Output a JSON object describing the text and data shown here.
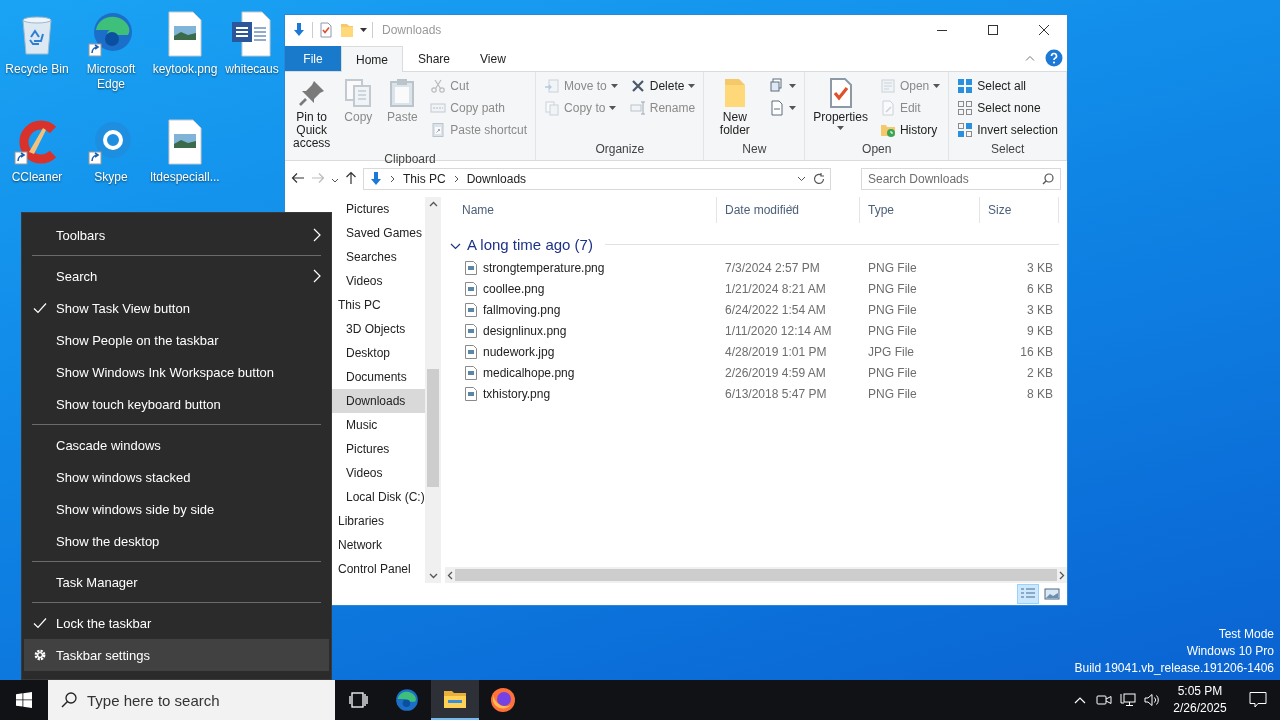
{
  "desktop": {
    "icons": [
      {
        "label": "Recycle Bin"
      },
      {
        "label": "Microsoft Edge"
      },
      {
        "label": "keytook.png"
      },
      {
        "label": "whitecaus"
      },
      {
        "label": "CCleaner"
      },
      {
        "label": "Skype"
      },
      {
        "label": "ltdespeciall..."
      }
    ],
    "watermark": [
      "Test Mode",
      "Windows 10 Pro",
      "Build 19041.vb_release.191206-1406"
    ]
  },
  "explorer": {
    "title": "Downloads",
    "tabs": [
      {
        "label": "File",
        "kind": "file",
        "selected": false
      },
      {
        "label": "Home",
        "kind": "tab",
        "selected": true
      },
      {
        "label": "Share",
        "kind": "tab",
        "selected": false
      },
      {
        "label": "View",
        "kind": "tab",
        "selected": false
      }
    ],
    "ribbon": [
      {
        "label": "Clipboard",
        "columns": [
          [
            {
              "label": "Pin to Quick access",
              "kind": "large",
              "disabled": false,
              "dropdown": false
            }
          ],
          [
            {
              "label": "Copy",
              "kind": "large",
              "disabled": true,
              "dropdown": false
            }
          ],
          [
            {
              "label": "Paste",
              "kind": "large",
              "disabled": true,
              "dropdown": false
            }
          ],
          [
            {
              "label": "Cut",
              "kind": "small",
              "disabled": true,
              "dropdown": false
            },
            {
              "label": "Copy path",
              "kind": "small",
              "disabled": true,
              "dropdown": false
            },
            {
              "label": "Paste shortcut",
              "kind": "small",
              "disabled": true,
              "dropdown": false
            }
          ]
        ]
      },
      {
        "label": "Organize",
        "columns": [
          [
            {
              "label": "Move to",
              "kind": "small",
              "disabled": true,
              "dropdown": true
            },
            {
              "label": "Copy to",
              "kind": "small",
              "disabled": true,
              "dropdown": true
            }
          ],
          [
            {
              "label": "Delete",
              "kind": "small",
              "disabled": false,
              "dropdown": true
            },
            {
              "label": "Rename",
              "kind": "small",
              "disabled": true,
              "dropdown": false
            }
          ]
        ]
      },
      {
        "label": "New",
        "columns": [
          [
            {
              "label": "New folder",
              "kind": "large",
              "disabled": false,
              "dropdown": false
            }
          ],
          [
            {
              "kind": "icon",
              "disabled": false,
              "dropdown": true
            },
            {
              "kind": "icon",
              "disabled": false,
              "dropdown": true
            }
          ]
        ]
      },
      {
        "label": "Open",
        "columns": [
          [
            {
              "label": "Properties",
              "kind": "large",
              "disabled": false,
              "dropdown": true
            }
          ],
          [
            {
              "label": "Open",
              "kind": "small",
              "disabled": true,
              "dropdown": true
            },
            {
              "label": "Edit",
              "kind": "small",
              "disabled": true,
              "dropdown": false
            },
            {
              "label": "History",
              "kind": "small",
              "disabled": false,
              "dropdown": false
            }
          ]
        ]
      },
      {
        "label": "Select",
        "columns": [
          [
            {
              "label": "Select all",
              "kind": "small",
              "disabled": false,
              "dropdown": false
            },
            {
              "label": "Select none",
              "kind": "small",
              "disabled": false,
              "dropdown": false
            },
            {
              "label": "Invert selection",
              "kind": "small",
              "disabled": false,
              "dropdown": false
            }
          ]
        ]
      }
    ],
    "path": [
      "This PC",
      "Downloads"
    ],
    "search": {
      "placeholder": "Search Downloads"
    },
    "nav": [
      {
        "label": "Pictures",
        "selected": false
      },
      {
        "label": "Saved Games",
        "selected": false
      },
      {
        "label": "Searches",
        "selected": false
      },
      {
        "label": "Videos",
        "selected": false
      },
      {
        "label": "This PC",
        "selected": false,
        "children": [
          {
            "label": "3D Objects",
            "selected": false
          },
          {
            "label": "Desktop",
            "selected": false
          },
          {
            "label": "Documents",
            "selected": false
          },
          {
            "label": "Downloads",
            "selected": true
          },
          {
            "label": "Music",
            "selected": false
          },
          {
            "label": "Pictures",
            "selected": false
          },
          {
            "label": "Videos",
            "selected": false
          },
          {
            "label": "Local Disk (C:)",
            "selected": false
          }
        ]
      },
      {
        "label": "Libraries",
        "selected": false
      },
      {
        "label": "Network",
        "selected": false
      },
      {
        "label": "Control Panel",
        "selected": false
      }
    ],
    "columns": [
      "Name",
      "Date modified",
      "Type",
      "Size"
    ],
    "group": {
      "label": "A long time ago (7)",
      "expanded": true
    },
    "files": [
      {
        "name": "strongtemperature.png",
        "date": "7/3/2024 2:57 PM",
        "type": "PNG File",
        "size": "3 KB"
      },
      {
        "name": "coollee.png",
        "date": "1/21/2024 8:21 AM",
        "type": "PNG File",
        "size": "6 KB"
      },
      {
        "name": "fallmoving.png",
        "date": "6/24/2022 1:54 AM",
        "type": "PNG File",
        "size": "3 KB"
      },
      {
        "name": "designlinux.png",
        "date": "1/11/2020 12:14 AM",
        "type": "PNG File",
        "size": "9 KB"
      },
      {
        "name": "nudework.jpg",
        "date": "4/28/2019 1:01 PM",
        "type": "JPG File",
        "size": "16 KB"
      },
      {
        "name": "medicalhope.png",
        "date": "2/26/2019 4:59 AM",
        "type": "PNG File",
        "size": "2 KB"
      },
      {
        "name": "txhistory.png",
        "date": "6/13/2018 5:47 PM",
        "type": "PNG File",
        "size": "8 KB"
      }
    ],
    "views": [
      {
        "kind": "details",
        "selected": true
      },
      {
        "kind": "large_icons",
        "selected": false
      }
    ]
  },
  "context_menu": {
    "items": [
      {
        "kind": "submenu",
        "label": "Toolbars",
        "checked": false,
        "selected": false
      },
      {
        "kind": "separator"
      },
      {
        "kind": "submenu",
        "label": "Search",
        "checked": false,
        "selected": false
      },
      {
        "kind": "item",
        "label": "Show Task View button",
        "checked": true,
        "selected": false
      },
      {
        "kind": "item",
        "label": "Show People on the taskbar",
        "checked": false,
        "selected": false
      },
      {
        "kind": "item",
        "label": "Show Windows Ink Workspace button",
        "checked": false,
        "selected": false
      },
      {
        "kind": "item",
        "label": "Show touch keyboard button",
        "checked": false,
        "selected": false
      },
      {
        "kind": "separator"
      },
      {
        "kind": "item",
        "label": "Cascade windows",
        "checked": false,
        "selected": false
      },
      {
        "kind": "item",
        "label": "Show windows stacked",
        "checked": false,
        "selected": false
      },
      {
        "kind": "item",
        "label": "Show windows side by side",
        "checked": false,
        "selected": false
      },
      {
        "kind": "item",
        "label": "Show the desktop",
        "checked": false,
        "selected": false
      },
      {
        "kind": "separator"
      },
      {
        "kind": "item",
        "label": "Task Manager",
        "checked": false,
        "selected": false
      },
      {
        "kind": "separator"
      },
      {
        "kind": "item",
        "label": "Lock the taskbar",
        "checked": true,
        "selected": false
      },
      {
        "kind": "settings",
        "label": "Taskbar settings",
        "selected": true
      }
    ]
  },
  "taskbar": {
    "search": {
      "placeholder": "Type here to search"
    },
    "apps": [
      {
        "kind": "task_view",
        "active": false
      },
      {
        "kind": "edge",
        "active": false
      },
      {
        "kind": "explorer",
        "active": true
      },
      {
        "kind": "firefox",
        "active": false
      }
    ],
    "clock": {
      "time": "5:05 PM",
      "date": "2/26/2025"
    }
  }
}
